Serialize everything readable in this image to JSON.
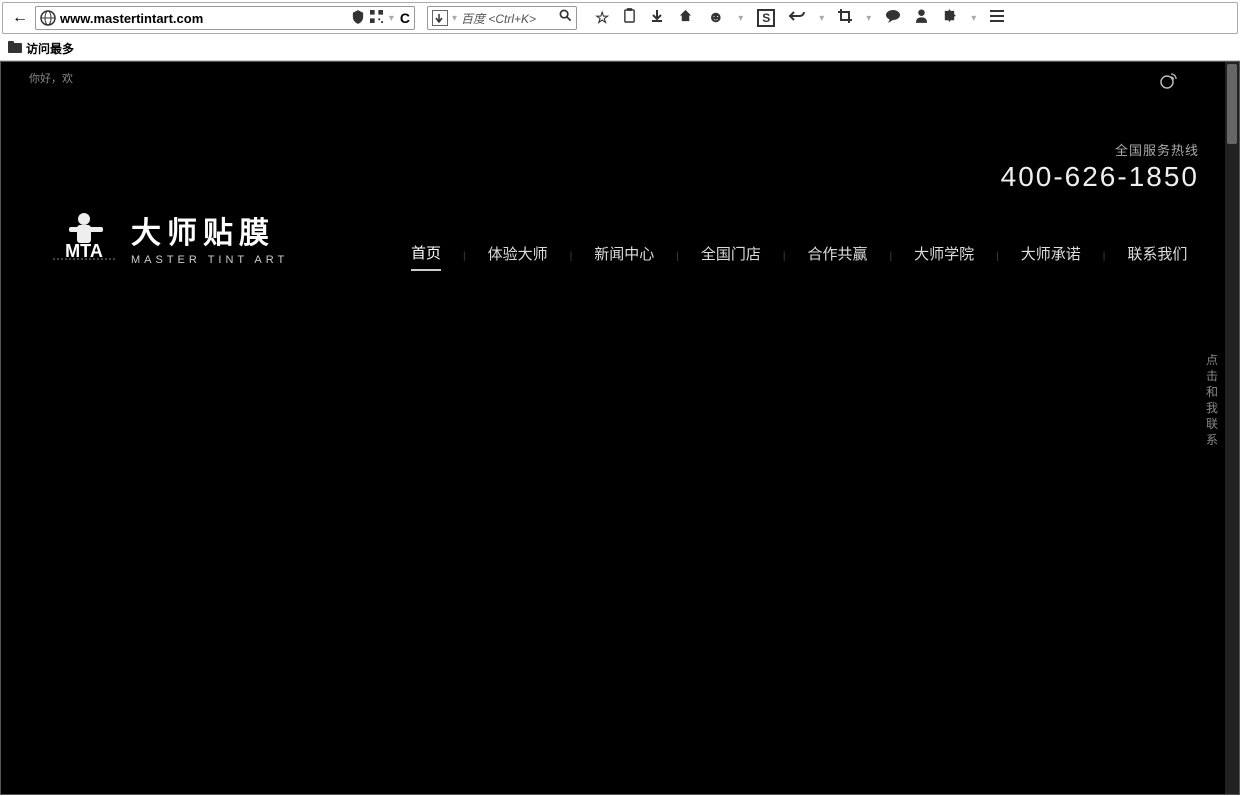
{
  "browser": {
    "url": "www.mastertintart.com",
    "search_placeholder": "百度 <Ctrl+K>",
    "bookmarks_label": "访问最多"
  },
  "header": {
    "greeting": "你好，欢",
    "hotline_label": "全国服务热线",
    "hotline_number": "400-626-1850"
  },
  "logo": {
    "acronym": "MTA",
    "name_cn": "大师贴膜",
    "name_en": "MASTER TINT ART"
  },
  "nav": {
    "items": [
      {
        "label": "首页",
        "active": true
      },
      {
        "label": "体验大师",
        "active": false
      },
      {
        "label": "新闻中心",
        "active": false
      },
      {
        "label": "全国门店",
        "active": false
      },
      {
        "label": "合作共赢",
        "active": false
      },
      {
        "label": "大师学院",
        "active": false
      },
      {
        "label": "大师承诺",
        "active": false
      },
      {
        "label": "联系我们",
        "active": false
      }
    ]
  },
  "side_contact": "点击和我联系"
}
